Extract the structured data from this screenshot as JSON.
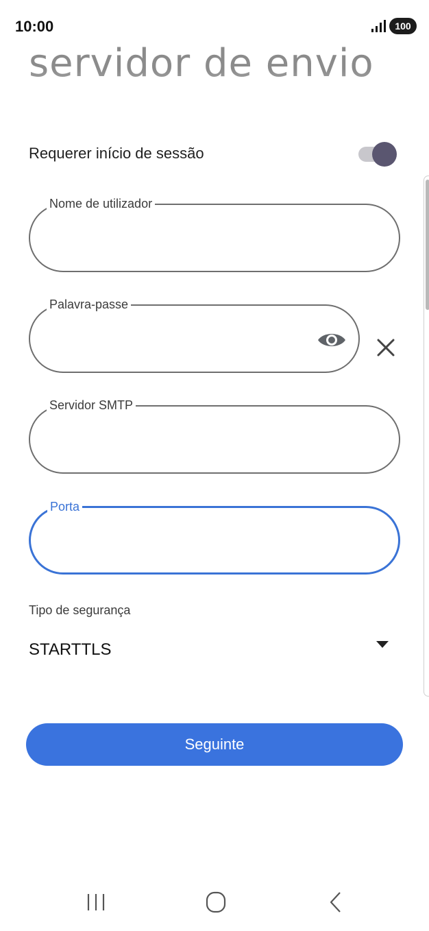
{
  "status_bar": {
    "time": "10:00",
    "battery": "100",
    "signal_icon": "signal-bars-icon"
  },
  "page": {
    "title": "servidor de envio"
  },
  "login": {
    "label": "Requerer início de sessão",
    "enabled": true
  },
  "fields": {
    "username": {
      "label": "Nome de utilizador",
      "value": ""
    },
    "password": {
      "label": "Palavra-passe",
      "value": "",
      "show_icon": "eye-icon",
      "clear_icon": "close-icon"
    },
    "smtp_server": {
      "label": "Servidor SMTP",
      "value": ""
    },
    "port": {
      "label": "Porta",
      "value": "",
      "focused": true
    }
  },
  "security": {
    "label": "Tipo de segurança",
    "value": "STARTTLS",
    "arrow_icon": "dropdown-arrow-icon"
  },
  "next_button": {
    "label": "Seguinte"
  },
  "nav_bar": {
    "recents_icon": "recents-icon",
    "home_icon": "home-icon",
    "back_icon": "back-icon"
  },
  "colors": {
    "accent": "#3a73de",
    "focused_outline": "#3a73d6",
    "toggle_thumb": "#5a5670",
    "toggle_track": "#c8c7cc",
    "outline": "#6e6e6e"
  }
}
